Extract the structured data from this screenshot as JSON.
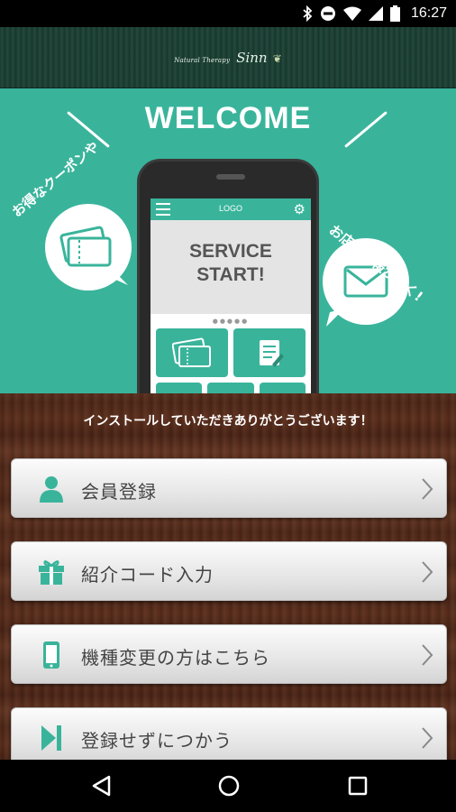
{
  "status_bar": {
    "time": "16:27",
    "icons": [
      "bluetooth-icon",
      "do-not-disturb-icon",
      "wifi-icon",
      "signal-icon",
      "battery-icon"
    ]
  },
  "header": {
    "brand_small": "Natural Therapy",
    "brand_name": "Sinn"
  },
  "hero": {
    "title": "WELCOME",
    "left_bubble_text": "お得なクーポンや",
    "right_bubble_text": "お店の情報が届く!",
    "phone": {
      "logo": "LOGO",
      "banner_line1": "SERVICE",
      "banner_line2": "START!",
      "dots": "●●●●●"
    }
  },
  "thanks_text": "インストールしていただきありがとうございます！",
  "menu": [
    {
      "label": "会員登録",
      "icon": "user-icon"
    },
    {
      "label": "紹介コード入力",
      "icon": "gift-icon"
    },
    {
      "label": "機種変更の方はこちら",
      "icon": "smartphone-icon"
    },
    {
      "label": "登録せずにつかう",
      "icon": "skip-icon"
    }
  ],
  "colors": {
    "accent": "#39b49b",
    "header": "#1f4438",
    "wood": "#512819"
  },
  "nav": [
    "back-icon",
    "home-icon",
    "recents-icon"
  ]
}
